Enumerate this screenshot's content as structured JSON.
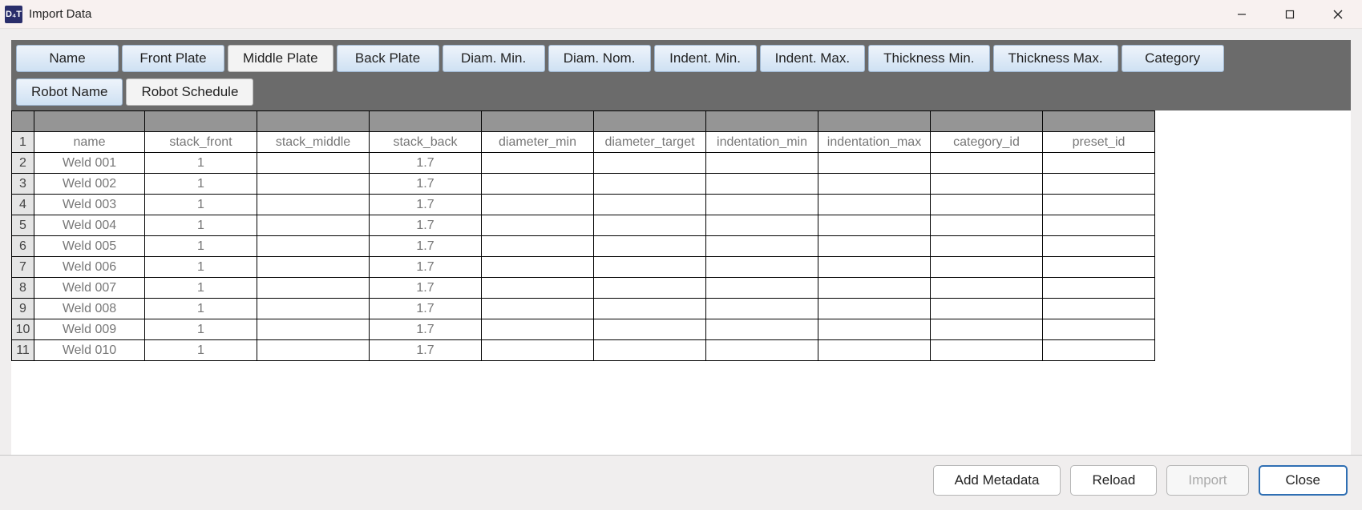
{
  "window": {
    "title": "Import Data",
    "icon_text": "D₄T"
  },
  "column_buttons": {
    "row1": [
      {
        "label": "Name",
        "selected": true
      },
      {
        "label": "Front Plate",
        "selected": true
      },
      {
        "label": "Middle Plate",
        "selected": false
      },
      {
        "label": "Back Plate",
        "selected": true
      },
      {
        "label": "Diam. Min.",
        "selected": true
      },
      {
        "label": "Diam. Nom.",
        "selected": true
      },
      {
        "label": "Indent. Min.",
        "selected": true
      },
      {
        "label": "Indent. Max.",
        "selected": true
      },
      {
        "label": "Thickness Min.",
        "selected": true
      },
      {
        "label": "Thickness Max.",
        "selected": true
      },
      {
        "label": "Category",
        "selected": true
      }
    ],
    "row2": [
      {
        "label": "Robot Name",
        "selected": true
      },
      {
        "label": "Robot Schedule",
        "selected": false
      }
    ]
  },
  "sheet": {
    "headers": [
      "name",
      "stack_front",
      "stack_middle",
      "stack_back",
      "diameter_min",
      "diameter_target",
      "indentation_min",
      "indentation_max",
      "category_id",
      "preset_id"
    ],
    "rows": [
      {
        "n": "2",
        "cells": [
          "Weld 001",
          "1",
          "",
          "1.7",
          "",
          "",
          "",
          "",
          "",
          ""
        ]
      },
      {
        "n": "3",
        "cells": [
          "Weld 002",
          "1",
          "",
          "1.7",
          "",
          "",
          "",
          "",
          "",
          ""
        ]
      },
      {
        "n": "4",
        "cells": [
          "Weld 003",
          "1",
          "",
          "1.7",
          "",
          "",
          "",
          "",
          "",
          ""
        ]
      },
      {
        "n": "5",
        "cells": [
          "Weld 004",
          "1",
          "",
          "1.7",
          "",
          "",
          "",
          "",
          "",
          ""
        ]
      },
      {
        "n": "6",
        "cells": [
          "Weld 005",
          "1",
          "",
          "1.7",
          "",
          "",
          "",
          "",
          "",
          ""
        ]
      },
      {
        "n": "7",
        "cells": [
          "Weld 006",
          "1",
          "",
          "1.7",
          "",
          "",
          "",
          "",
          "",
          ""
        ]
      },
      {
        "n": "8",
        "cells": [
          "Weld 007",
          "1",
          "",
          "1.7",
          "",
          "",
          "",
          "",
          "",
          ""
        ]
      },
      {
        "n": "9",
        "cells": [
          "Weld 008",
          "1",
          "",
          "1.7",
          "",
          "",
          "",
          "",
          "",
          ""
        ]
      },
      {
        "n": "10",
        "cells": [
          "Weld 009",
          "1",
          "",
          "1.7",
          "",
          "",
          "",
          "",
          "",
          ""
        ]
      },
      {
        "n": "11",
        "cells": [
          "Weld 010",
          "1",
          "",
          "1.7",
          "",
          "",
          "",
          "",
          "",
          ""
        ]
      }
    ],
    "header_rownum": "1"
  },
  "footer": {
    "add_metadata": "Add Metadata",
    "reload": "Reload",
    "import": "Import",
    "close": "Close"
  }
}
